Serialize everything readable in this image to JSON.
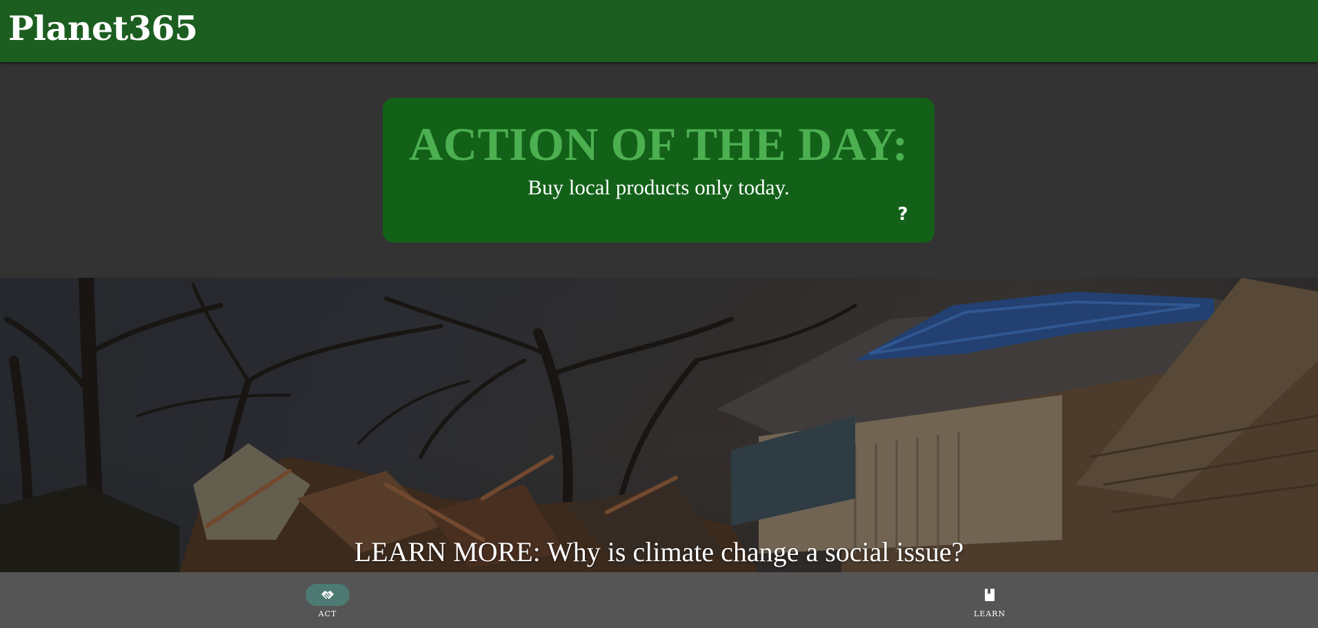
{
  "app": {
    "title": "Planet365"
  },
  "action_card": {
    "heading": "ACTION OF THE DAY:",
    "text": "Buy local products only today.",
    "help_label": "?"
  },
  "hero": {
    "caption": "LEARN MORE: Why is climate change a social issue?"
  },
  "bottom_nav": {
    "items": [
      {
        "label": "ACT",
        "icon": "handshake-icon",
        "active": true
      },
      {
        "label": "LEARN",
        "icon": "book-icon",
        "active": false
      }
    ]
  },
  "colors": {
    "app_bar": "#1c5e20",
    "card_background": "#136119",
    "card_heading": "#4caf50",
    "page_background": "#333333",
    "bottom_nav": "#555555",
    "active_indicator": "#4e7a74"
  }
}
